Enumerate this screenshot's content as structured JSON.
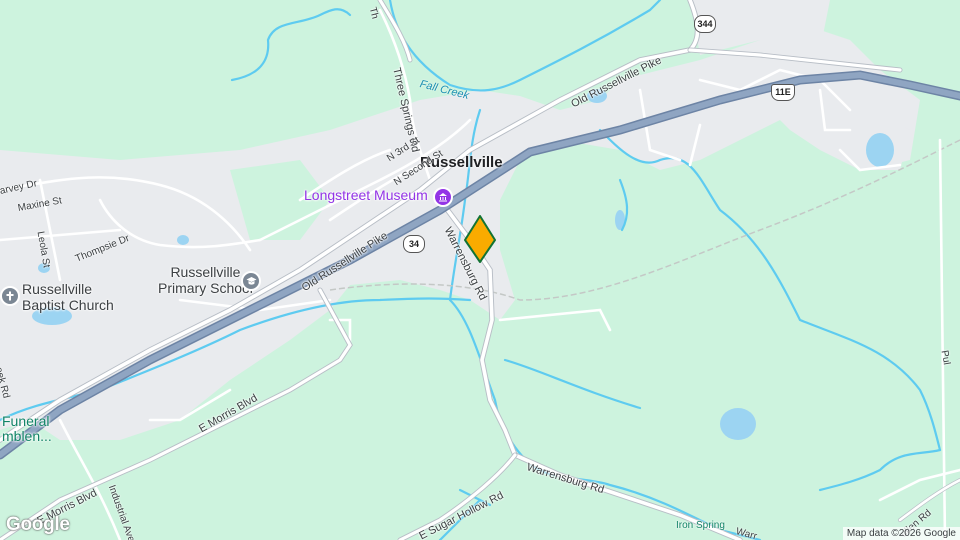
{
  "map": {
    "town_label": "Russellville",
    "places": {
      "museum": "Longstreet Museum",
      "school_line1": "Russellville",
      "school_line2": "Primary School",
      "church_line1": "Russellville",
      "church_line2": "Baptist Church",
      "funeral_line1": "Funeral",
      "funeral_line2": "mblen...",
      "iron_spring": "Iron Spring"
    },
    "water": {
      "fall_creek": "Fall Creek"
    },
    "roads": {
      "old_russellville_pike_north": "Old Russellville Pike",
      "old_russellville_pike_south": "Old Russellville Pike",
      "three_springs_rd": "Three Springs Rd",
      "n_3rd_st": "N 3rd St",
      "n_second_st": "N Second St",
      "warrensburg_rd_north": "Warrensburg Rd",
      "warrensburg_rd_south": "Warrensburg Rd",
      "e_morris_blvd_upper": "E Morris Blvd",
      "e_morris_blvd_lower": "E Morris Blvd",
      "e_sugar_hollow_rd": "E Sugar Hollow Rd",
      "industrial_ave": "Industrial Ave",
      "maxine_st": "Maxine St",
      "leola_st": "Leola St",
      "thompsie_dr": "Thompsie Dr",
      "harvey_dr": "arvey Dr",
      "creek_rd": "eek Rd",
      "mullen_rd": "ullen Rd",
      "warr_fragment": "Warr",
      "pul_fragment": "Pul",
      "th_fragment": "Th"
    },
    "shields": {
      "sr_344": "344",
      "sr_34": "34",
      "us_11e": "11E"
    },
    "attribution": "Map data ©2026 Google",
    "logo": "Google",
    "colors": {
      "land_green": "#cdf3de",
      "urban": "#e8eaed",
      "highway": "#8a9fbc",
      "water": "#5ecbf0",
      "marker": "#f9ab00"
    }
  }
}
